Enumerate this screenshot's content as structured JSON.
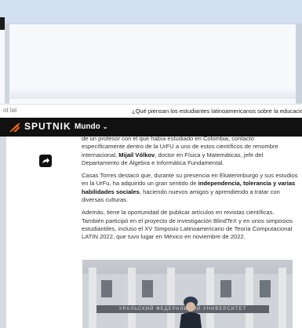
{
  "address_bar": {
    "side_label": "ot lat",
    "tab_title": "¿Qué piensan los estudiantes latinoamericanos sobre la educación en"
  },
  "site": {
    "logo": "SPUTNIK",
    "section": "Mundo",
    "section_chevron": "chevron-down-icon"
  },
  "article": {
    "p1": "de un profesor con el que había estudiado en Colombia, contactó específicamente dentro de la UrFU a uno de estos científicos de renombre internacional, Mijaíl Vólkov, doctor en Física y Matemáticas, jefe del Departamento de Álgebra e Informática Fundamental.",
    "p2_a": "Casas Torres destacó que, durante su presencia en Ekaterimburgo y sus estudios en la UrFu, ha adquirido un gran sentido de ",
    "p2_b": "independencia, tolerancia y varias habilidades sociales",
    "p2_c": ", haciendo nuevos amigos y aprendiendo a tratar con diversas culturas.",
    "p3": "Además, tiene la oportunidad de publicar artículos en revistas científicas. También participó en el proyecto de investigación BlindTeX y en unos simposios estudiantiles, incluso el XV Simposio Latinoamericano de Teoría Computacional LATIN 2022, que tuvo lugar en México en noviembre de 2022.",
    "photo_sign": "УРАЛЬСКИЙ ФЕДЕРАЛЬНЫЙ УНИВЕРСИТЕТ"
  },
  "colors": {
    "header_bg": "#111111",
    "logo_accent": "#f26a1b"
  }
}
